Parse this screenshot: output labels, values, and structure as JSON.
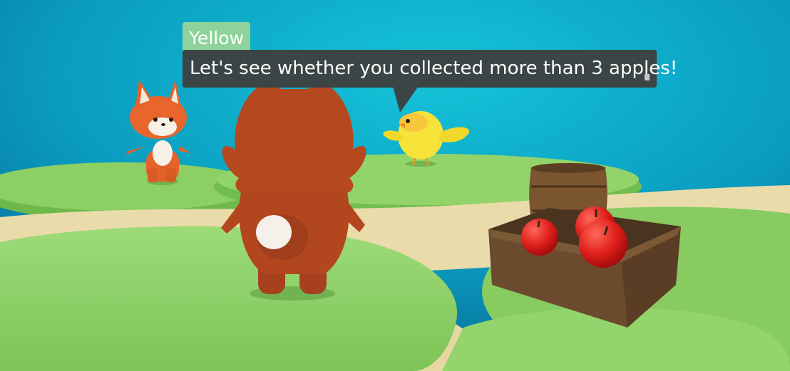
{
  "dialog": {
    "speaker": "Yellow",
    "text": "Let's see whether you collected more than 3 apples!"
  },
  "colors": {
    "sky": "#0a9cc0",
    "grass": "#8ccf63",
    "path": "#e9dcaa",
    "speaker_tag": "#8fd39b",
    "dialog_bg": "#3b4545"
  }
}
